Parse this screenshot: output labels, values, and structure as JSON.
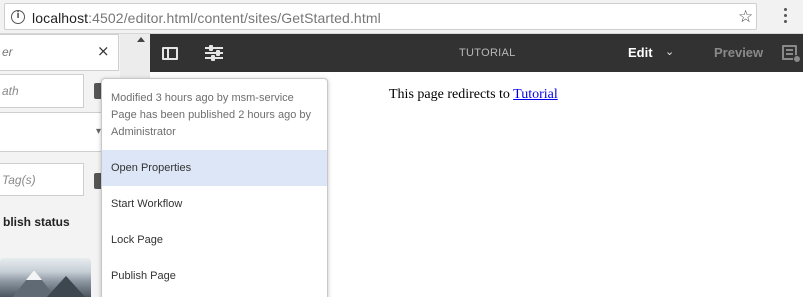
{
  "browser": {
    "url_host": "localhost",
    "url_rest": ":4502/editor.html/content/sites/GetStarted.html",
    "info_icon": "info-icon",
    "bookmark_icon": "star-icon",
    "menu_icon": "kebab-icon"
  },
  "sidepanel": {
    "search_value": "er",
    "path_placeholder": "ath",
    "tags_placeholder": "Tag(s)",
    "publish_status_label": "blish status",
    "clear_icon": "close-icon"
  },
  "toolbar": {
    "title": "TUTORIAL",
    "edit_label": "Edit",
    "preview_label": "Preview",
    "background": "#323232"
  },
  "page": {
    "redirect_prefix": "This page redirects to",
    "redirect_link": "Tutorial"
  },
  "popover": {
    "info_line1": "Modified 3 hours ago by msm-service",
    "info_line2": "Page has been published 2 hours ago by",
    "info_line3": "Administrator",
    "menu": [
      {
        "label": "Open Properties",
        "active": true
      },
      {
        "label": "Start Workflow",
        "active": false
      },
      {
        "label": "Lock Page",
        "active": false
      },
      {
        "label": "Publish Page",
        "active": false
      }
    ],
    "active_color": "#dce6f6"
  }
}
